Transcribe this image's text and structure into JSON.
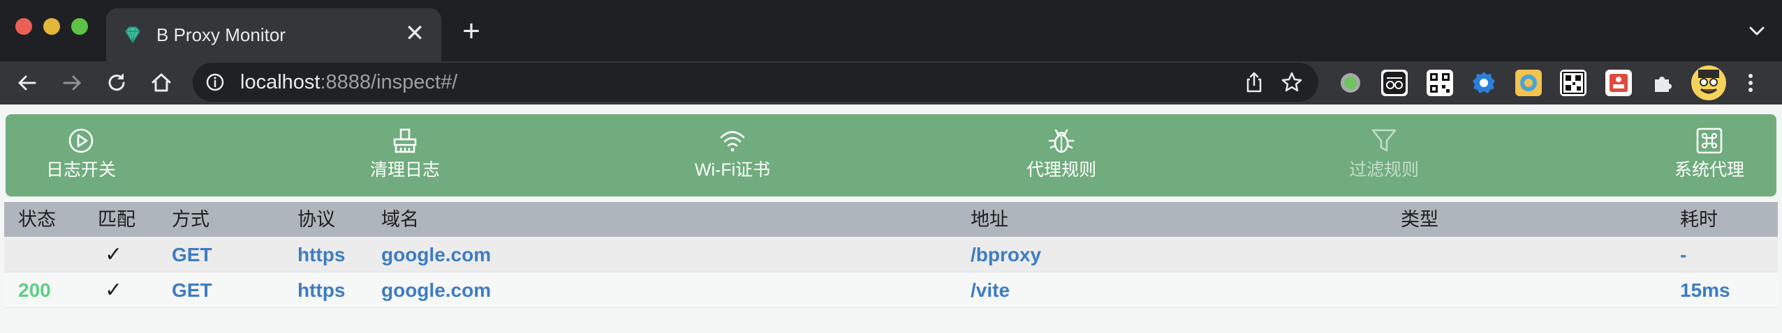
{
  "browser": {
    "tab_title": "B Proxy Monitor",
    "tab_close": "✕",
    "new_tab": "+",
    "url_host": "localhost",
    "url_rest": ":8888/inspect#/",
    "colors": {
      "tabbar": "#1f2023",
      "toolbar": "#35363a",
      "omnibox": "#202124"
    },
    "extensions": [
      "green-circle-ext-icon",
      "glasses-ext-icon",
      "qr-code-ext-icon",
      "gear-ext-icon",
      "image-ext-icon",
      "qr-scan-ext-icon",
      "red-ext-icon",
      "puzzle-icon",
      "profile-avatar"
    ]
  },
  "actions": [
    {
      "label": "日志开关",
      "icon": "play-circle-icon",
      "enabled": true
    },
    {
      "label": "清理日志",
      "icon": "broom-icon",
      "enabled": true
    },
    {
      "label": "Wi-Fi证书",
      "icon": "wifi-icon",
      "enabled": true
    },
    {
      "label": "代理规则",
      "icon": "bug-icon",
      "enabled": true
    },
    {
      "label": "过滤规则",
      "icon": "filter-icon",
      "enabled": false
    },
    {
      "label": "系统代理",
      "icon": "command-icon",
      "enabled": true
    }
  ],
  "table": {
    "headers": [
      "状态",
      "匹配",
      "方式",
      "协议",
      "域名",
      "地址",
      "类型",
      "耗时"
    ],
    "rows": [
      {
        "status": "",
        "match": "✓",
        "method": "GET",
        "protocol": "https",
        "domain": "google.com",
        "path": "/bproxy",
        "type": "",
        "time": "-"
      },
      {
        "status": "200",
        "match": "✓",
        "method": "GET",
        "protocol": "https",
        "domain": "google.com",
        "path": "/vite",
        "type": "",
        "time": "15ms"
      }
    ]
  },
  "theme": {
    "accent_green": "#70ac7d",
    "link_blue": "#3e7cc2",
    "status_green": "#5fce84",
    "header_gray": "#aeb5bd"
  }
}
